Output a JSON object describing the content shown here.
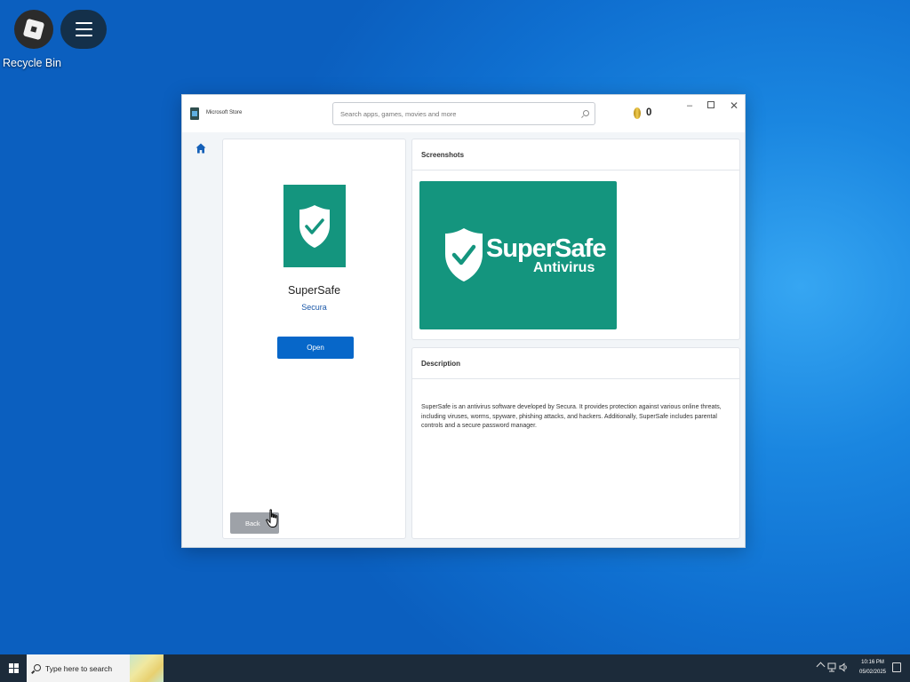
{
  "desktop": {
    "icons": [
      {
        "label": "Recycle Bin"
      }
    ]
  },
  "store": {
    "app_title": "Microsoft Store",
    "search_placeholder": "Search apps, games, movies and more",
    "coin_count": "0",
    "window_controls": {
      "minimize": "–",
      "close": "✕"
    },
    "app": {
      "name": "SuperSafe",
      "publisher": "Secura",
      "open_label": "Open",
      "back_label": "Back"
    },
    "screenshots": {
      "header": "Screenshots",
      "image_title": "SuperSafe",
      "image_subtitle": "Antivirus"
    },
    "description": {
      "header": "Description",
      "text": "SuperSafe is an antivirus software developed by Secura. It provides protection against various online threats, including viruses, worms, spyware, phishing attacks, and hackers. Additionally, SuperSafe includes parental controls and a secure password manager."
    },
    "colors": {
      "tile": "#14957e",
      "open_button": "#0767c9",
      "publisher": "#1a57a8"
    }
  },
  "taskbar": {
    "search_placeholder": "Type here to search",
    "clock_time": "10:16 PM",
    "clock_date": "05/02/2025"
  }
}
